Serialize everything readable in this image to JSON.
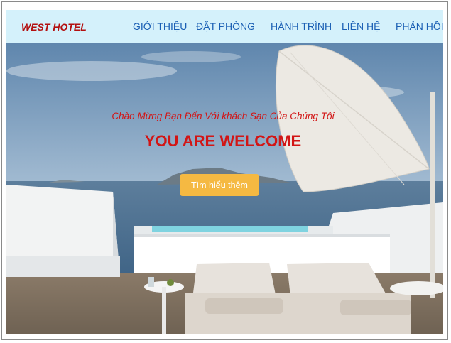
{
  "nav": {
    "brand": "WEST HOTEL",
    "links": [
      "GIỚI THIỆU",
      "ĐẶT PHÒNG",
      "HÀNH TRÌNH",
      "LIÊN HỆ",
      "PHẢN HỒI"
    ]
  },
  "hero": {
    "tagline": "Chào Mừng Bạn Đến Với khách Sạn Của Chúng Tôi",
    "headline": "YOU ARE WELCOME",
    "cta_label": "Tìm hiểu thêm"
  },
  "colors": {
    "navbar_bg": "#d4f1fb",
    "brand": "#b30f0f",
    "link": "#1a5fb4",
    "headline": "#d21515",
    "cta": "#f5b942"
  }
}
